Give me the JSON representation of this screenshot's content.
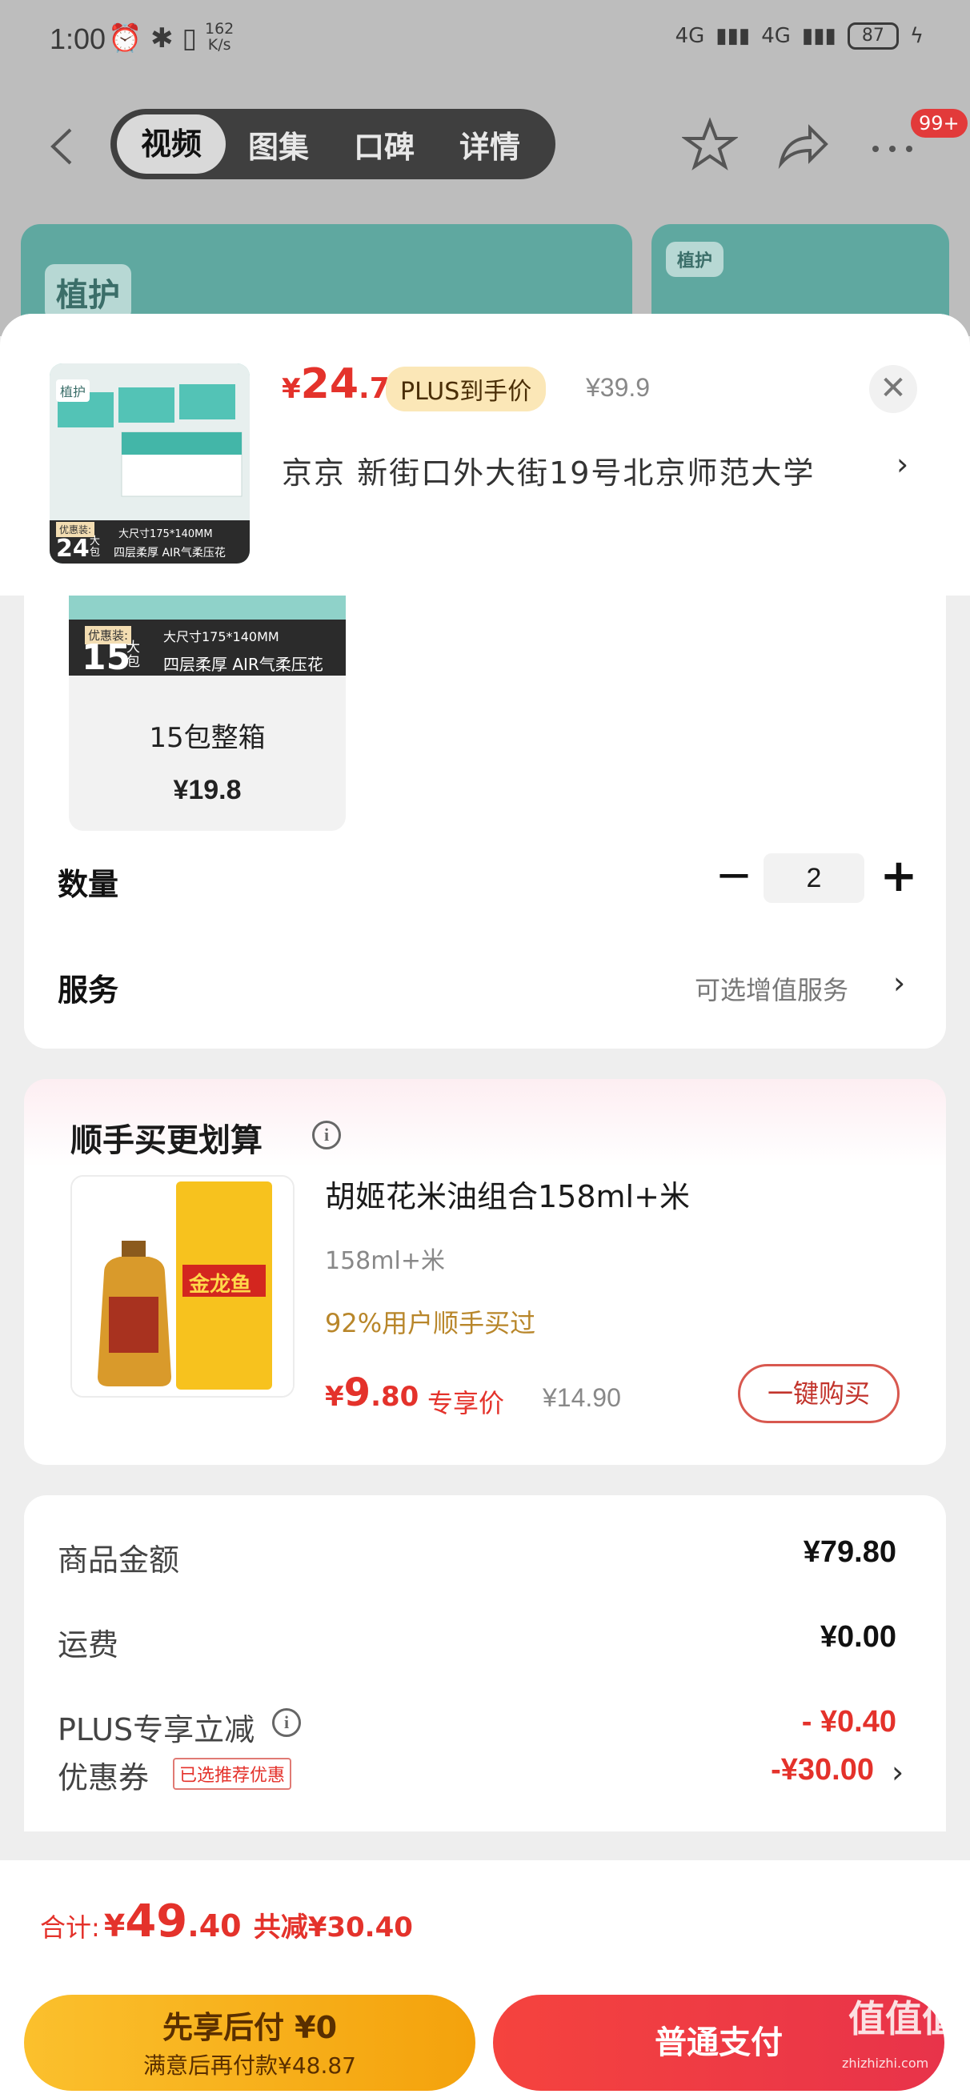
{
  "status_bar": {
    "time": "1:00",
    "speed_value": "162",
    "speed_unit": "K/s",
    "network1": "4G",
    "network2": "4G",
    "battery": "87"
  },
  "nav": {
    "tabs": [
      {
        "label": "视频"
      },
      {
        "label": "图集"
      },
      {
        "label": "口碑"
      },
      {
        "label": "详情"
      }
    ],
    "badge": "99+"
  },
  "banner": {
    "tag": "植护",
    "tag2": "植护"
  },
  "product": {
    "price_currency": "¥",
    "price_integer": "24",
    "price_decimal": ".7",
    "plus_label": "PLUS到手价",
    "original_price": "¥39.9",
    "thumb_tag": "植护",
    "thumb_promo_label": "优惠装:",
    "thumb_count": "24",
    "thumb_unit": "大包",
    "thumb_size": "大尺寸175*140MM",
    "thumb_feature": "四层柔厚 AIR气柔压花"
  },
  "address": {
    "text": "京京   新街口外大街19号北京师范大学"
  },
  "spec": {
    "promo_label": "优惠装:",
    "count": "15",
    "unit": "大包",
    "size": "大尺寸175*140MM",
    "feature": "四层柔厚 AIR气柔压花",
    "label": "15包整箱",
    "price": "¥19.8"
  },
  "quantity": {
    "label": "数量",
    "value": "2"
  },
  "service": {
    "label": "服务",
    "hint": "可选增值服务"
  },
  "upsell": {
    "title": "顺手买更划算",
    "name": "胡姬花米油组合158ml+米",
    "spec": "158ml+米",
    "social": "92%用户顺手买过",
    "price_currency": "¥",
    "price_integer": "9",
    "price_decimal": ".80",
    "exclusive_label": "专享价",
    "original_price": "¥14.90",
    "buy_button": "一键购买",
    "brand_text": "金龙鱼"
  },
  "summary": {
    "rows": [
      {
        "label": "商品金额",
        "value": "¥79.80"
      },
      {
        "label": "运费",
        "value": "¥0.00"
      },
      {
        "label": "PLUS专享立减",
        "value": "- ¥0.40"
      },
      {
        "label": "优惠券",
        "value": "-¥30.00"
      }
    ],
    "coupon_tag": "已选推荐优惠"
  },
  "footer": {
    "total_label": "合计:",
    "total_currency": "¥",
    "total_integer": "49",
    "total_decimal": ".40",
    "saving": "共减¥30.40",
    "later_line1": "先享后付 ¥0",
    "later_line2": "满意后再付款¥48.87",
    "pay_button": "普通支付"
  },
  "watermark": {
    "text": "值值值",
    "sub": "zhizhizhi.com"
  },
  "colors": {
    "accent_red": "#e4322b",
    "plus_pill": "#fbe7b7",
    "later_button": "#f4a20c",
    "pay_button": "#e8334a"
  }
}
